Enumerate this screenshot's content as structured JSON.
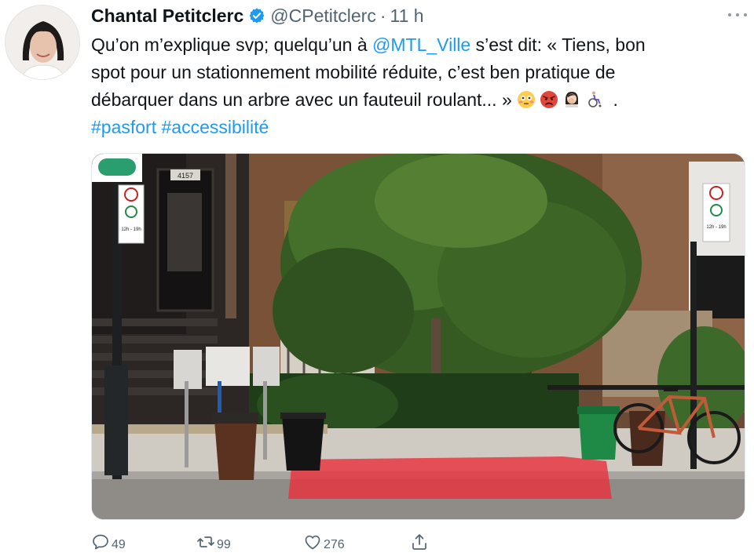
{
  "author": {
    "name": "Chantal Petitclerc",
    "handle": "@CPetitclerc",
    "separator": "·",
    "time": "11 h",
    "verified_icon": "verified-badge-icon"
  },
  "tweet": {
    "line1_prefix": "Qu’on m’explique svp;  quelqu’un à ",
    "mention": "@MTL_Ville",
    "line1_suffix": " s’est dit:  « Tiens, bon",
    "line2": "spot pour un stationnement mobilité réduite,  c’est ben pratique de",
    "line3_text": "débarquer dans un arbre avec un fauteuil roulant... »  ",
    "line3_emojis": [
      "flushed-face-emoji",
      "angry-face-emoji",
      "woman-facepalming-emoji",
      "person-in-wheelchair-emoji"
    ],
    "line3_end": " .",
    "hashtags": [
      "#pasfort",
      "#accessibilité"
    ]
  },
  "photo": {
    "building_number": "4157",
    "sign_text": "12h - 19h",
    "description_icon": "parking-sign-icon"
  },
  "actions": {
    "reply_count": "49",
    "retweet_count": "99",
    "like_count": "276",
    "share_icon": "share-icon"
  },
  "colors": {
    "link": "#1d9bf0",
    "verified": "#1d9bf0",
    "secondary_text": "#536471",
    "highlight": "#e8323e"
  }
}
